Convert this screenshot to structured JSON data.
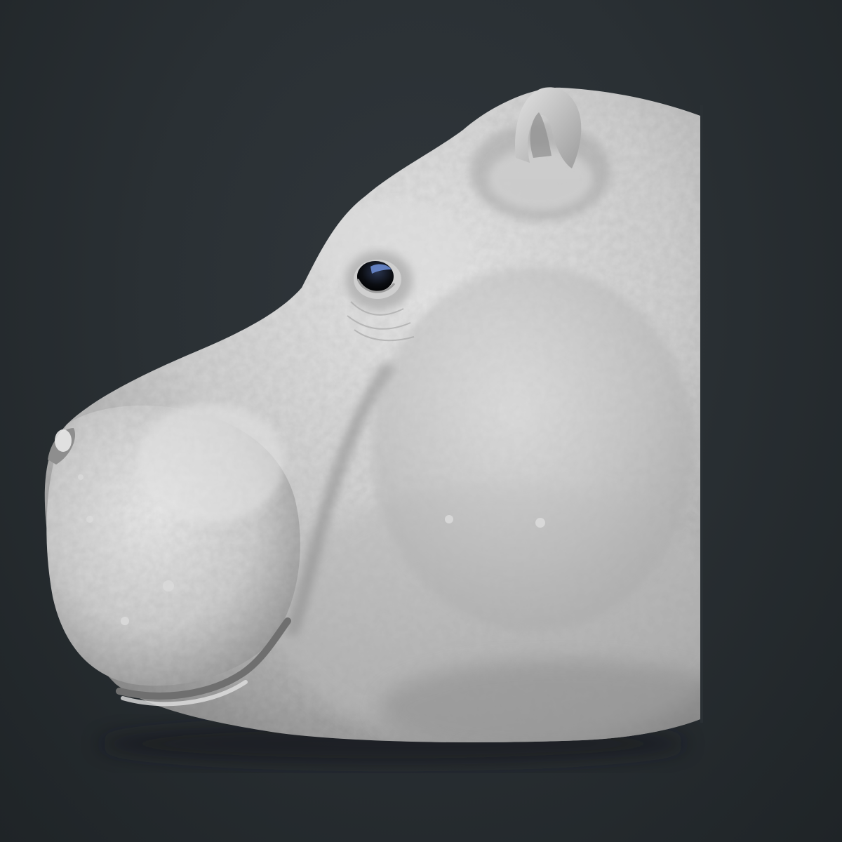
{
  "scene": {
    "subject": "hippo-head-sculpt",
    "background_color": "#2b3135",
    "material_color": "#c9c9c9",
    "eye_color": "#0b0d12",
    "eye_highlight_color": "#6f8fd8"
  }
}
